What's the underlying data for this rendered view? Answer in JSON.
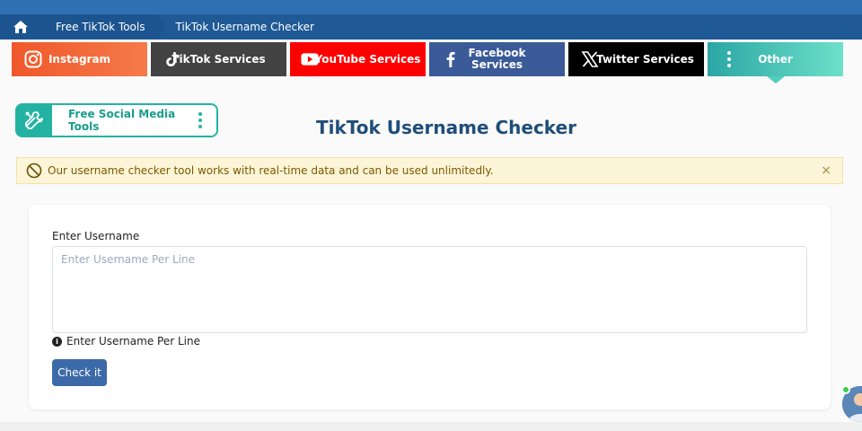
{
  "breadcrumb": {
    "home_icon": "home-icon",
    "items": [
      {
        "label": "Free TikTok Tools"
      },
      {
        "label": "TikTok Username Checker"
      }
    ]
  },
  "services": [
    {
      "label": "Instagram",
      "icon": "instagram-icon",
      "color": "#f0582a"
    },
    {
      "label": "TikTok Services",
      "icon": "tiktok-icon",
      "color": "#434343"
    },
    {
      "label": "YouTube Services",
      "icon": "youtube-icon",
      "color": "#ff0000"
    },
    {
      "label": "Facebook Services",
      "icon": "facebook-icon",
      "color": "#3b5a98"
    },
    {
      "label": "Twitter Services",
      "icon": "x-icon",
      "color": "#000000"
    },
    {
      "label": "Other",
      "icon": "kebab-icon",
      "color": "#2aa6a4"
    }
  ],
  "tools_button": {
    "label": "Free Social Media Tools",
    "icon": "tools-icon"
  },
  "page_title": "TikTok Username Checker",
  "alert": {
    "text": "Our username checker tool works with real-time data and can be used unlimitedly.",
    "close": "×",
    "icon": "ban-icon"
  },
  "form": {
    "label": "Enter Username",
    "placeholder": "Enter Username Per Line",
    "value": "",
    "hint": "Enter Username Per Line",
    "submit_label": "Check it"
  }
}
